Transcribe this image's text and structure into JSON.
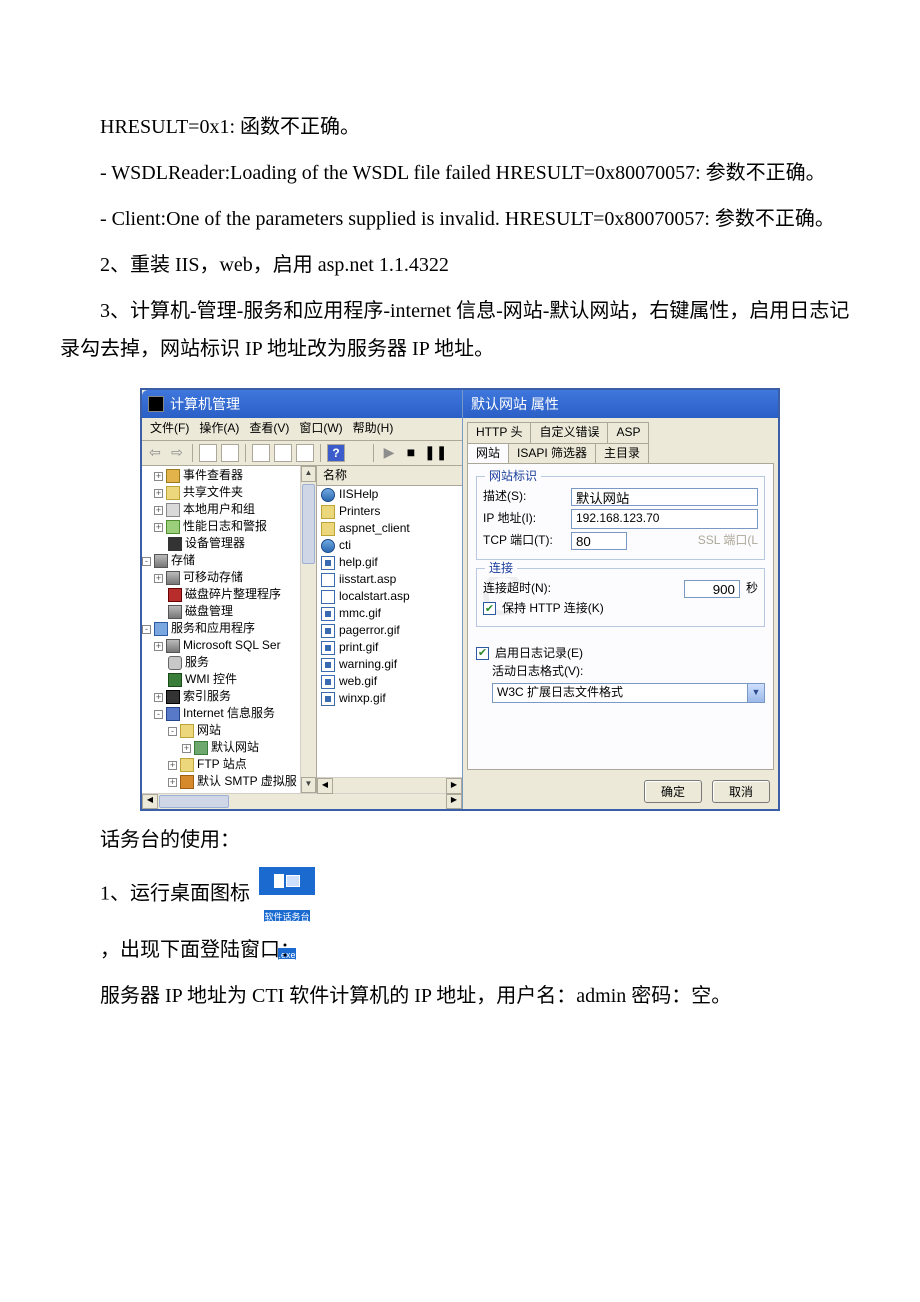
{
  "paragraphs": {
    "p1": "HRESULT=0x1: 函数不正确。",
    "p2": "- WSDLReader:Loading of the WSDL file failed HRESULT=0x80070057: 参数不正确。",
    "p3": "- Client:One of the parameters supplied is invalid. HRESULT=0x80070057: 参数不正确。",
    "p4": "2、重装 IIS，web，启用 asp.net 1.1.4322",
    "p5": "3、计算机-管理-服务和应用程序-internet 信息-网站-默认网站，右键属性，启用日志记录勾去掉，网站标识 IP 地址改为服务器 IP 地址。",
    "after1": "话务台的使用：",
    "after2a": "1、运行桌面图标",
    "after3": "，出现下面登陆窗口：",
    "after4": "服务器 IP 地址为 CTI 软件计算机的 IP 地址，用户名：admin 密码：空。"
  },
  "attendant_icon": {
    "line1": "软件话务台",
    "line2": ".exe"
  },
  "mmc": {
    "title": "计算机管理",
    "menu": {
      "file": "文件(F)",
      "action": "操作(A)",
      "view": "查看(V)",
      "window": "窗口(W)",
      "help": "帮助(H)"
    },
    "tree": {
      "event_viewer": "事件查看器",
      "shared_folders": "共享文件夹",
      "local_users": "本地用户和组",
      "perf_logs": "性能日志和警报",
      "device_mgr": "设备管理器",
      "storage": "存储",
      "removable": "可移动存储",
      "defrag": "磁盘碎片整理程序",
      "disk_mgmt": "磁盘管理",
      "services_apps": "服务和应用程序",
      "mssql": "Microsoft SQL Ser",
      "services": "服务",
      "wmi": "WMI 控件",
      "index": "索引服务",
      "iis": "Internet 信息服务",
      "websites": "网站",
      "default_site": "默认网站",
      "ftp": "FTP 站点",
      "smtp": "默认 SMTP 虚拟服"
    },
    "list": {
      "header": "名称",
      "items": [
        {
          "icon": "globe",
          "text": "IISHelp"
        },
        {
          "icon": "folder",
          "text": "Printers"
        },
        {
          "icon": "folder",
          "text": "aspnet_client"
        },
        {
          "icon": "globe",
          "text": "cti"
        },
        {
          "icon": "gif",
          "text": "help.gif"
        },
        {
          "icon": "asp",
          "text": "iisstart.asp"
        },
        {
          "icon": "asp",
          "text": "localstart.asp"
        },
        {
          "icon": "gif",
          "text": "mmc.gif"
        },
        {
          "icon": "gif",
          "text": "pagerror.gif"
        },
        {
          "icon": "gif",
          "text": "print.gif"
        },
        {
          "icon": "gif",
          "text": "warning.gif"
        },
        {
          "icon": "gif",
          "text": "web.gif"
        },
        {
          "icon": "gif",
          "text": "winxp.gif"
        }
      ]
    }
  },
  "props": {
    "title": "默认网站 属性",
    "tabs_row1": {
      "http": "HTTP 头",
      "custom_err": "自定义错误",
      "asp": "ASP"
    },
    "tabs_row2": {
      "site": "网站",
      "isapi": "ISAPI 筛选器",
      "home": "主目录"
    },
    "group_identity": {
      "legend": "网站标识",
      "desc_label": "描述(S):",
      "desc_value": "默认网站",
      "ip_label": "IP 地址(I):",
      "ip_value": "192.168.123.70",
      "tcp_label": "TCP 端口(T):",
      "tcp_value": "80",
      "ssl_label": "SSL 端口(L"
    },
    "group_conn": {
      "legend": "连接",
      "timeout_label": "连接超时(N):",
      "timeout_value": "900",
      "timeout_unit": "秒",
      "keepalive": "保持 HTTP 连接(K)"
    },
    "group_log": {
      "enable": "启用日志记录(E)",
      "format_label": "活动日志格式(V):",
      "format_value": "W3C 扩展日志文件格式"
    },
    "buttons": {
      "ok": "确定",
      "cancel": "取消"
    }
  }
}
